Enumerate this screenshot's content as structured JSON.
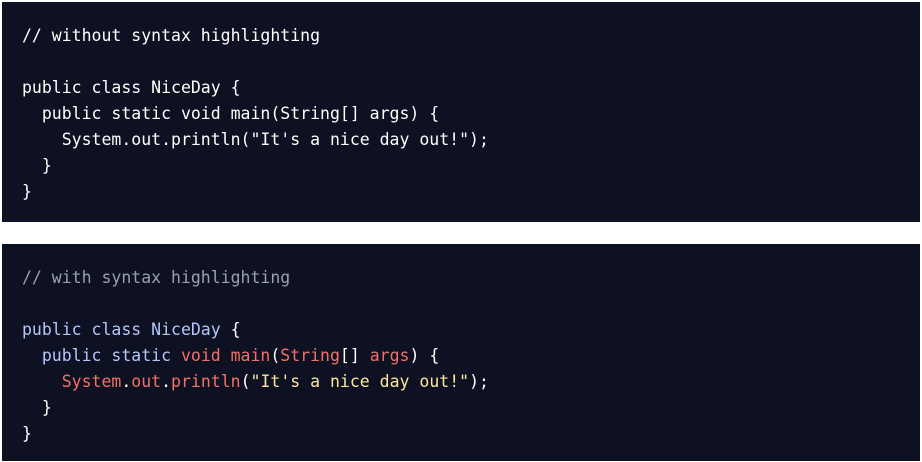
{
  "colors": {
    "background": "#0d1121",
    "page": "#ffffff",
    "plain_text": "#ffffff",
    "comment": "#9aa0ab",
    "keyword": "#b4c6fb",
    "function": "#f47067",
    "string": "#fde69c",
    "punctuation": "#ffffff"
  },
  "blocks": [
    {
      "name": "without-highlighting",
      "lines": [
        [
          {
            "t": "// without syntax highlighting",
            "k": "plain"
          }
        ],
        [],
        [
          {
            "t": "public class NiceDay {",
            "k": "plain"
          }
        ],
        [
          {
            "t": "  public static void main(String[] args) {",
            "k": "plain"
          }
        ],
        [
          {
            "t": "    System.out.println(\"It's a nice day out!\");",
            "k": "plain"
          }
        ],
        [
          {
            "t": "  }",
            "k": "plain"
          }
        ],
        [
          {
            "t": "}",
            "k": "plain"
          }
        ]
      ]
    },
    {
      "name": "with-highlighting",
      "lines": [
        [
          {
            "t": "// with syntax highlighting",
            "k": "comment"
          }
        ],
        [],
        [
          {
            "t": "public class NiceDay",
            "k": "keyword"
          },
          {
            "t": " {",
            "k": "punctuation"
          }
        ],
        [
          {
            "t": "  public static ",
            "k": "keyword"
          },
          {
            "t": "void main",
            "k": "function"
          },
          {
            "t": "(",
            "k": "punctuation"
          },
          {
            "t": "String",
            "k": "function"
          },
          {
            "t": "[] ",
            "k": "punctuation"
          },
          {
            "t": "args",
            "k": "function"
          },
          {
            "t": ") {",
            "k": "punctuation"
          }
        ],
        [
          {
            "t": "    ",
            "k": "plain"
          },
          {
            "t": "System",
            "k": "function"
          },
          {
            "t": ".",
            "k": "punctuation"
          },
          {
            "t": "out",
            "k": "function"
          },
          {
            "t": ".",
            "k": "punctuation"
          },
          {
            "t": "println",
            "k": "function"
          },
          {
            "t": "(",
            "k": "punctuation"
          },
          {
            "t": "\"It's a nice day out!\"",
            "k": "string"
          },
          {
            "t": ");",
            "k": "punctuation"
          }
        ],
        [
          {
            "t": "  }",
            "k": "punctuation"
          }
        ],
        [
          {
            "t": "}",
            "k": "punctuation"
          }
        ]
      ]
    }
  ]
}
